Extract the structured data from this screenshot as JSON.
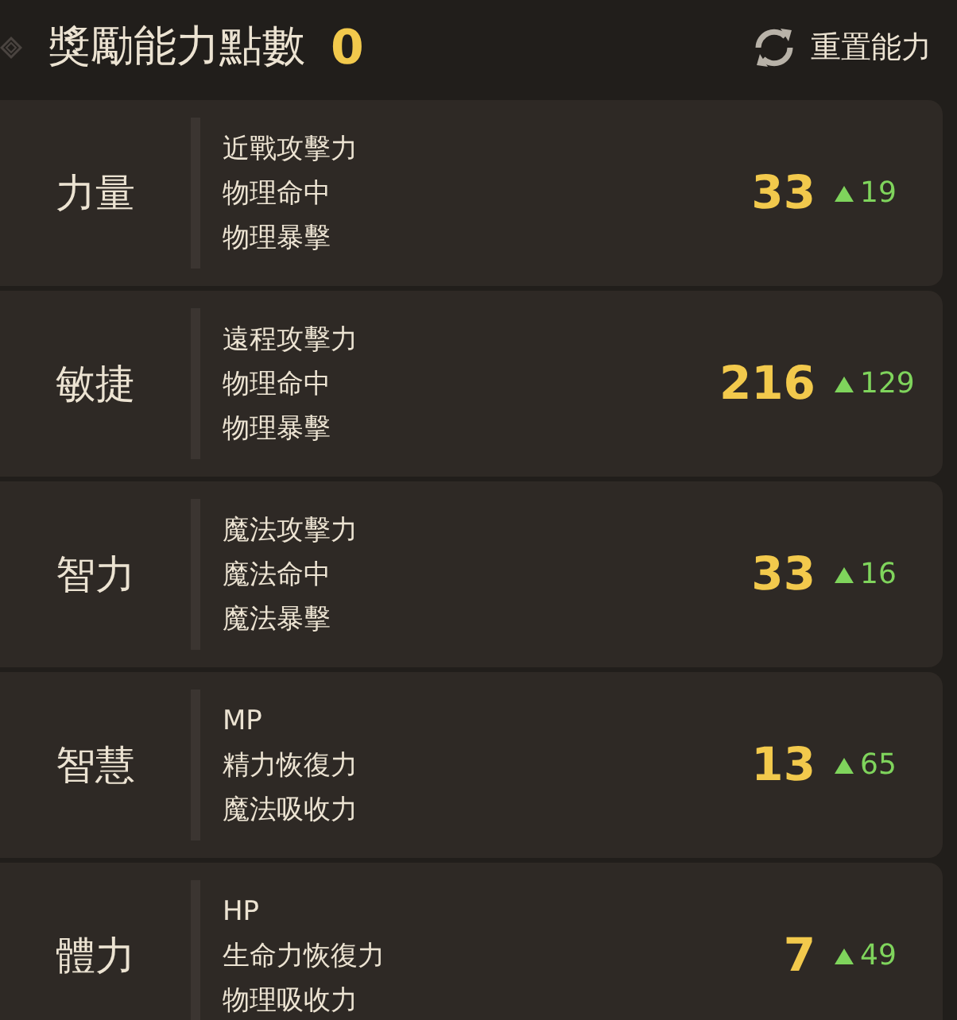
{
  "header": {
    "title": "獎勵能力點數",
    "points": "0",
    "reset_label": "重置能力"
  },
  "stats": [
    {
      "name": "力量",
      "effects": [
        "近戰攻擊力",
        "物理命中",
        "物理暴擊"
      ],
      "value": "33",
      "bonus": "19"
    },
    {
      "name": "敏捷",
      "effects": [
        "遠程攻擊力",
        "物理命中",
        "物理暴擊"
      ],
      "value": "216",
      "bonus": "129"
    },
    {
      "name": "智力",
      "effects": [
        "魔法攻擊力",
        "魔法命中",
        "魔法暴擊"
      ],
      "value": "33",
      "bonus": "16"
    },
    {
      "name": "智慧",
      "effects": [
        "MP",
        "精力恢復力",
        "魔法吸收力"
      ],
      "value": "13",
      "bonus": "65"
    },
    {
      "name": "體力",
      "effects": [
        "HP",
        "生命力恢復力",
        "物理吸收力"
      ],
      "value": "7",
      "bonus": "49"
    }
  ]
}
